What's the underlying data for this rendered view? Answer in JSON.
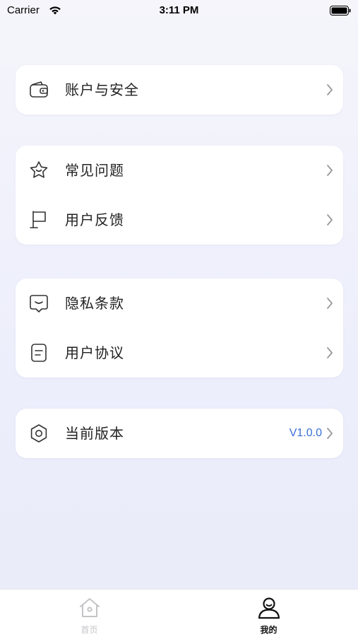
{
  "status_bar": {
    "carrier": "Carrier",
    "time": "3:11 PM"
  },
  "groups": [
    {
      "items": [
        {
          "label": "账户与安全",
          "icon": "wallet-icon"
        }
      ]
    },
    {
      "items": [
        {
          "label": "常见问题",
          "icon": "star-face-icon"
        },
        {
          "label": "用户反馈",
          "icon": "flag-icon"
        }
      ]
    },
    {
      "items": [
        {
          "label": "隐私条款",
          "icon": "chat-smile-icon"
        },
        {
          "label": "用户协议",
          "icon": "document-icon"
        }
      ]
    },
    {
      "items": [
        {
          "label": "当前版本",
          "icon": "hexagon-icon",
          "value": "V1.0.0"
        }
      ]
    }
  ],
  "tab_bar": {
    "tabs": [
      {
        "label": "首页",
        "icon": "home-icon",
        "active": false
      },
      {
        "label": "我的",
        "icon": "user-icon",
        "active": true
      }
    ]
  },
  "colors": {
    "accent": "#3a6fd8",
    "inactive_tab": "#c4c4c8",
    "background": "#eceefb"
  }
}
